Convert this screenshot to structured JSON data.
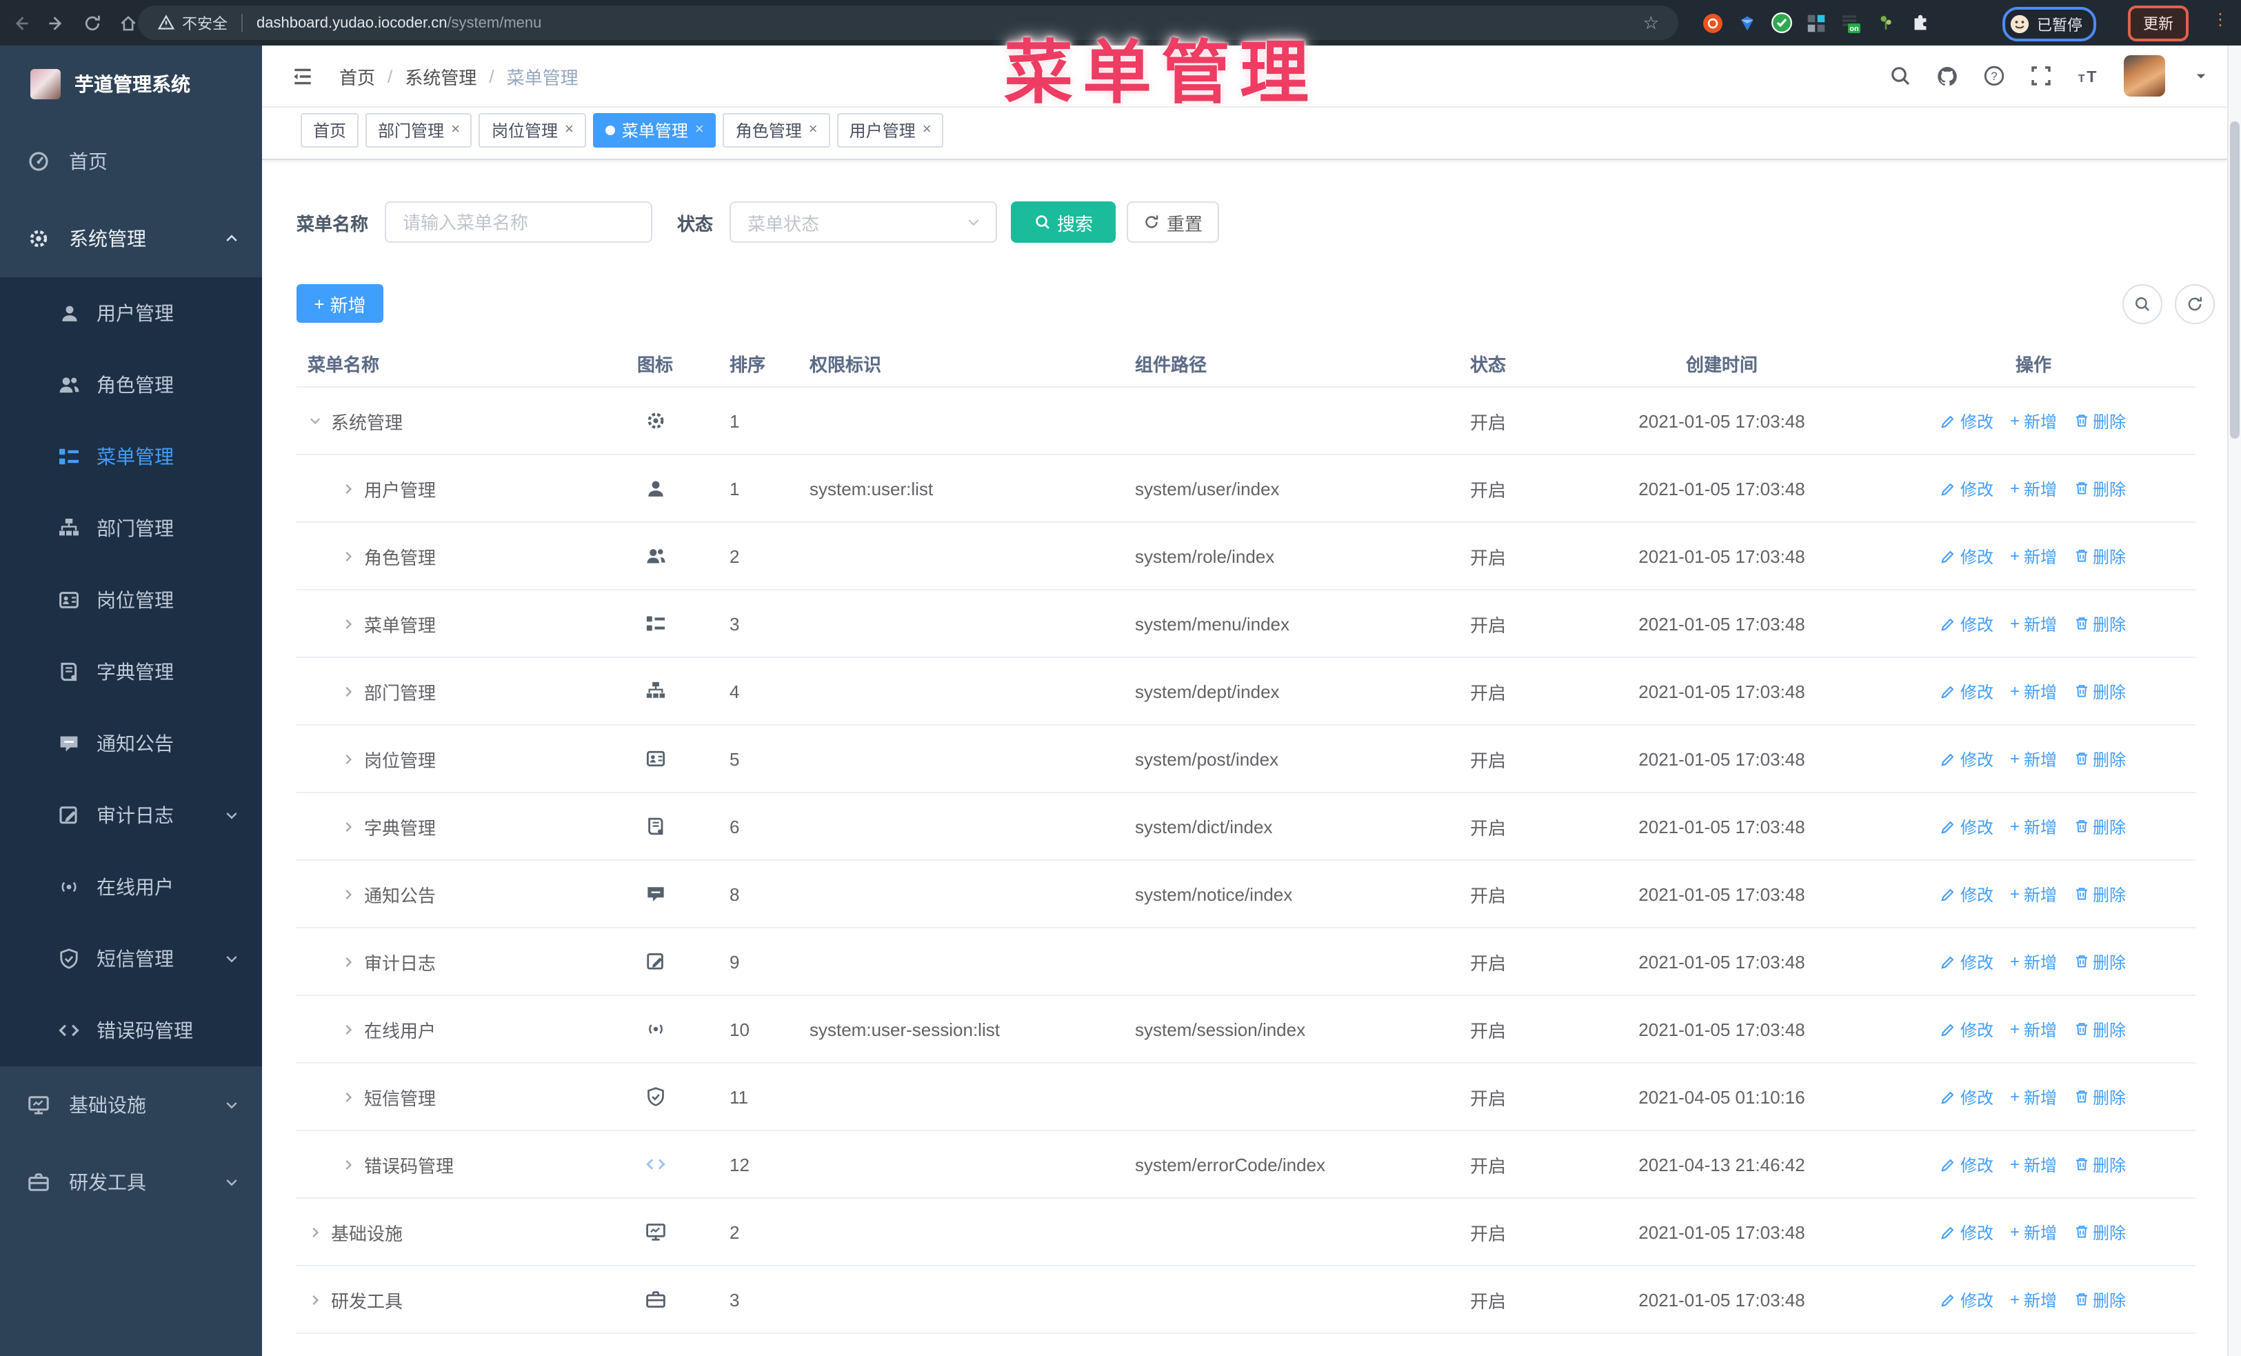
{
  "browser": {
    "security_label": "不安全",
    "url_host": "dashboard.yudao.iocoder.cn",
    "url_path": "/system/menu",
    "paused_badge": "已暂停",
    "update_button": "更新",
    "extension_icons": [
      "ubuntu-extension",
      "gem-extension",
      "check-extension",
      "grid-extension",
      "list-on-extension",
      "plant-extension",
      "puzzle-extension"
    ]
  },
  "overlay_title": "菜单管理",
  "sidebar": {
    "logo_title": "芋道管理系统",
    "items": [
      {
        "label": "首页",
        "icon": "dashboard",
        "level": 0
      },
      {
        "label": "系统管理",
        "icon": "gear",
        "level": 0,
        "arrow": "up",
        "active_parent": true
      },
      {
        "label": "用户管理",
        "icon": "user",
        "level": 1
      },
      {
        "label": "角色管理",
        "icon": "users",
        "level": 1
      },
      {
        "label": "菜单管理",
        "icon": "menu",
        "level": 1,
        "active": true
      },
      {
        "label": "部门管理",
        "icon": "tree",
        "level": 1
      },
      {
        "label": "岗位管理",
        "icon": "badge",
        "level": 1
      },
      {
        "label": "字典管理",
        "icon": "dict",
        "level": 1
      },
      {
        "label": "通知公告",
        "icon": "notice",
        "level": 1
      },
      {
        "label": "审计日志",
        "icon": "audit",
        "level": 1,
        "arrow": "down"
      },
      {
        "label": "在线用户",
        "icon": "online",
        "level": 1
      },
      {
        "label": "短信管理",
        "icon": "sms",
        "level": 1,
        "arrow": "down"
      },
      {
        "label": "错误码管理",
        "icon": "code",
        "level": 1
      },
      {
        "label": "基础设施",
        "icon": "infra",
        "level": 0,
        "arrow": "down"
      },
      {
        "label": "研发工具",
        "icon": "tools",
        "level": 0,
        "arrow": "down"
      }
    ]
  },
  "header": {
    "breadcrumb": [
      "首页",
      "系统管理",
      "菜单管理"
    ],
    "breadcrumb_separator": "/"
  },
  "tabs": [
    {
      "label": "首页",
      "closable": false,
      "active": false
    },
    {
      "label": "部门管理",
      "closable": true,
      "active": false
    },
    {
      "label": "岗位管理",
      "closable": true,
      "active": false
    },
    {
      "label": "菜单管理",
      "closable": true,
      "active": true
    },
    {
      "label": "角色管理",
      "closable": true,
      "active": false
    },
    {
      "label": "用户管理",
      "closable": true,
      "active": false
    }
  ],
  "filters": {
    "name_label": "菜单名称",
    "name_placeholder": "请输入菜单名称",
    "status_label": "状态",
    "status_placeholder": "菜单状态",
    "search_button": "搜索",
    "reset_button": "重置"
  },
  "toolbar": {
    "add_button": "新增"
  },
  "table": {
    "columns": [
      "菜单名称",
      "图标",
      "排序",
      "权限标识",
      "组件路径",
      "状态",
      "创建时间",
      "操作"
    ],
    "op_labels": {
      "edit": "修改",
      "add": "新增",
      "delete": "删除"
    },
    "rows": [
      {
        "name": "系统管理",
        "icon": "gear",
        "level": 0,
        "expanded": true,
        "sort": "1",
        "perm": "",
        "path": "",
        "status": "开启",
        "time": "2021-01-05 17:03:48"
      },
      {
        "name": "用户管理",
        "icon": "user",
        "level": 1,
        "expanded": false,
        "sort": "1",
        "perm": "system:user:list",
        "path": "system/user/index",
        "status": "开启",
        "time": "2021-01-05 17:03:48"
      },
      {
        "name": "角色管理",
        "icon": "users",
        "level": 1,
        "expanded": false,
        "sort": "2",
        "perm": "",
        "path": "system/role/index",
        "status": "开启",
        "time": "2021-01-05 17:03:48"
      },
      {
        "name": "菜单管理",
        "icon": "menu",
        "level": 1,
        "expanded": false,
        "sort": "3",
        "perm": "",
        "path": "system/menu/index",
        "status": "开启",
        "time": "2021-01-05 17:03:48"
      },
      {
        "name": "部门管理",
        "icon": "tree",
        "level": 1,
        "expanded": false,
        "sort": "4",
        "perm": "",
        "path": "system/dept/index",
        "status": "开启",
        "time": "2021-01-05 17:03:48"
      },
      {
        "name": "岗位管理",
        "icon": "badge",
        "level": 1,
        "expanded": false,
        "sort": "5",
        "perm": "",
        "path": "system/post/index",
        "status": "开启",
        "time": "2021-01-05 17:03:48"
      },
      {
        "name": "字典管理",
        "icon": "dict",
        "level": 1,
        "expanded": false,
        "sort": "6",
        "perm": "",
        "path": "system/dict/index",
        "status": "开启",
        "time": "2021-01-05 17:03:48"
      },
      {
        "name": "通知公告",
        "icon": "notice",
        "level": 1,
        "expanded": false,
        "sort": "8",
        "perm": "",
        "path": "system/notice/index",
        "status": "开启",
        "time": "2021-01-05 17:03:48"
      },
      {
        "name": "审计日志",
        "icon": "audit",
        "level": 1,
        "expanded": false,
        "sort": "9",
        "perm": "",
        "path": "",
        "status": "开启",
        "time": "2021-01-05 17:03:48"
      },
      {
        "name": "在线用户",
        "icon": "online",
        "level": 1,
        "expanded": false,
        "sort": "10",
        "perm": "system:user-session:list",
        "path": "system/session/index",
        "status": "开启",
        "time": "2021-01-05 17:03:48"
      },
      {
        "name": "短信管理",
        "icon": "sms",
        "level": 1,
        "expanded": false,
        "sort": "11",
        "perm": "",
        "path": "",
        "status": "开启",
        "time": "2021-04-05 01:10:16"
      },
      {
        "name": "错误码管理",
        "icon": "code",
        "level": 1,
        "expanded": false,
        "sort": "12",
        "perm": "",
        "path": "system/errorCode/index",
        "status": "开启",
        "time": "2021-04-13 21:46:42"
      },
      {
        "name": "基础设施",
        "icon": "infra",
        "level": 0,
        "expanded": false,
        "sort": "2",
        "perm": "",
        "path": "",
        "status": "开启",
        "time": "2021-01-05 17:03:48"
      },
      {
        "name": "研发工具",
        "icon": "tools",
        "level": 0,
        "expanded": false,
        "sort": "3",
        "perm": "",
        "path": "",
        "status": "开启",
        "time": "2021-01-05 17:03:48"
      }
    ]
  },
  "colors": {
    "primary": "#409eff",
    "search_button": "#1abc9c",
    "overlay_red": "#ee3c62",
    "sidebar_bg": "#2d4257",
    "submenu_bg": "#1d2f44"
  }
}
